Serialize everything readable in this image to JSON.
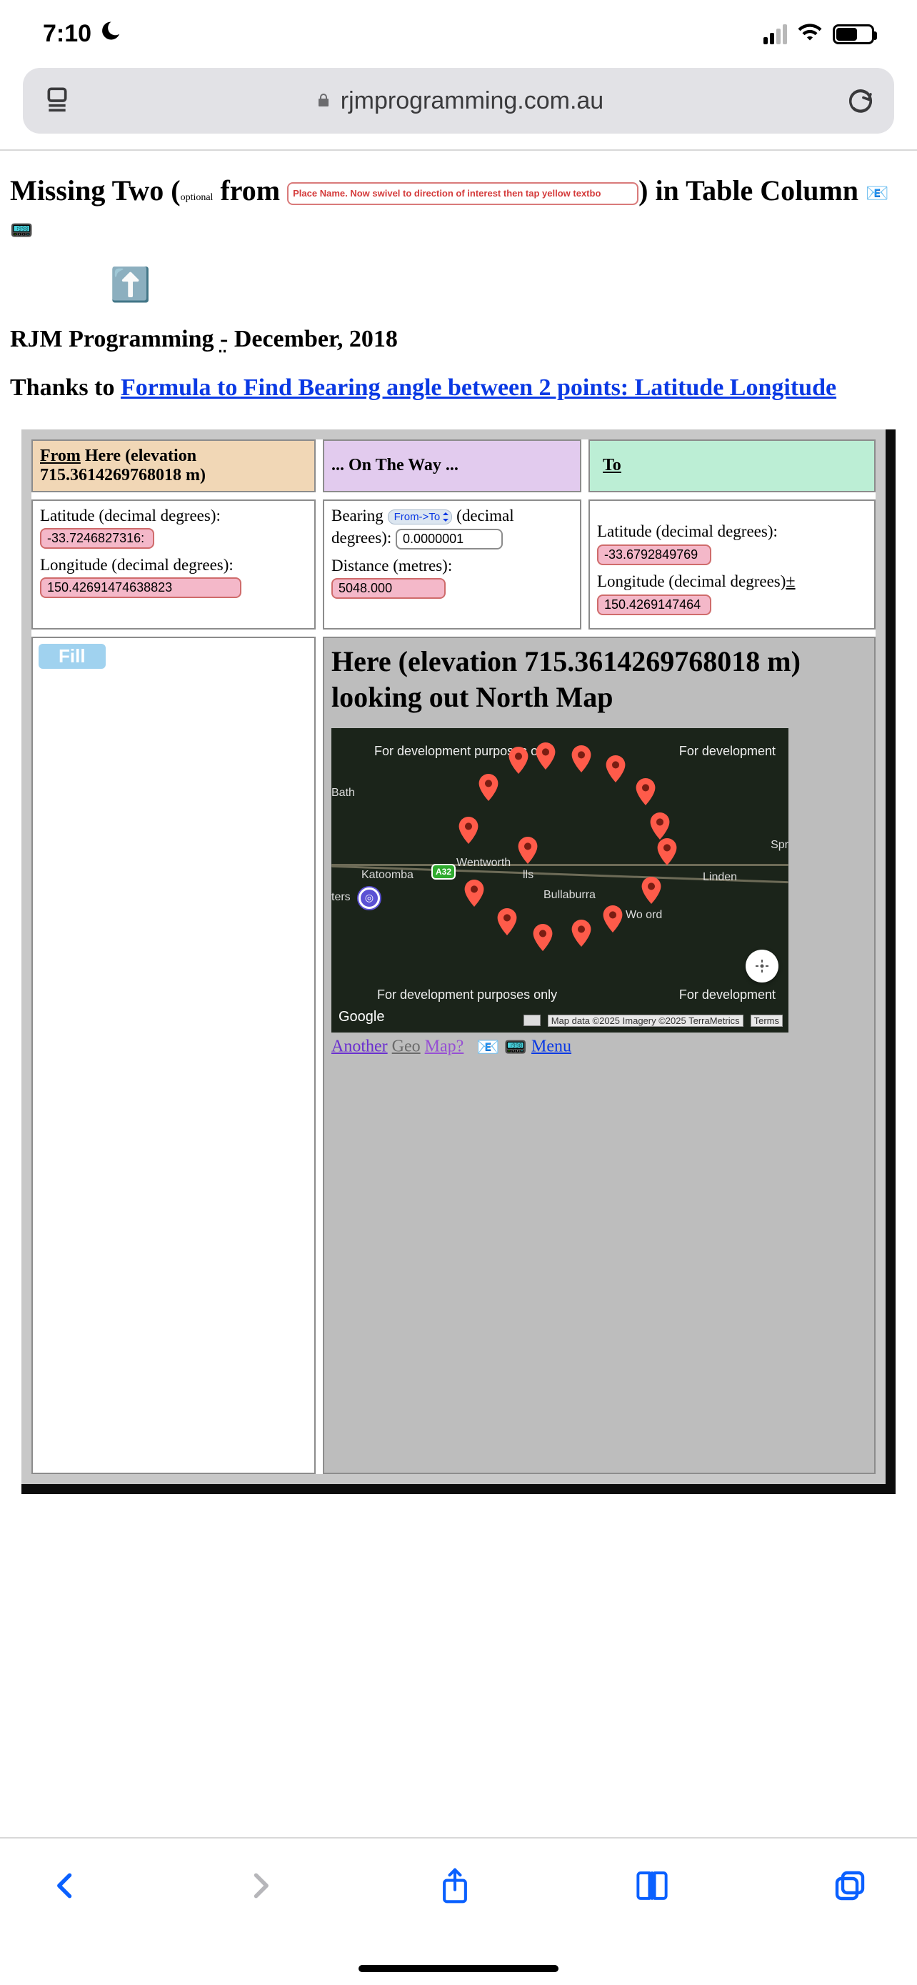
{
  "status": {
    "time": "7:10",
    "focus_mode": "moon"
  },
  "address_bar": {
    "domain": "rjmprogramming.com.au"
  },
  "heading": {
    "pre": "Missing Two (",
    "optional": "optional",
    "from_word": " from ",
    "place_placeholder": "Place Name. Now swivel to direction of interest then tap yellow textbo",
    "post": ") in Table Column "
  },
  "subheading": {
    "org": "RJM Programming ",
    "dash": "-",
    "rest": " December, 2018"
  },
  "thanks": {
    "pre": "Thanks to ",
    "link": "Formula to Find Bearing angle between 2 points: Latitude Longitude"
  },
  "table": {
    "from_header_pre": "From",
    "from_header_post": "  Here (elevation 715.3614269768018 m)",
    "way_header": "... On The Way ...",
    "to_header": "To",
    "from": {
      "lat_label": "Latitude (decimal degrees):",
      "lat_value": "-33.7246827316:",
      "lon_label": "Longitude (decimal degrees):",
      "lon_value": "150.42691474638823"
    },
    "way": {
      "bearing_label_pre": "Bearing ",
      "bearing_select": "From->To",
      "bearing_label_post": " (decimal degrees): ",
      "bearing_value": "0.0000001",
      "dist_label": "Distance (metres):",
      "dist_value": "5048.000"
    },
    "to": {
      "lat_label": "Latitude (decimal degrees): ",
      "lat_value": "-33.6792849769",
      "lon_label": "Longitude (decimal degrees)",
      "pm": "±",
      "lon_value": "150.4269147464"
    }
  },
  "fill_label": "Fill",
  "map_panel": {
    "title": "Here (elevation 715.3614269768018 m) looking out North Map",
    "dev_watermark": "For development purposes only",
    "dev_watermark_short": "For development",
    "places": {
      "katoomba": "Katoomba",
      "wentworth": "Wentworth",
      "lls": "lls",
      "bullaburra": "Bullaburra",
      "woodford": "Wo    ord",
      "linden": "Linden",
      "bath": "Bath",
      "ters": "ters",
      "spr": "Spr"
    },
    "shield": "A32",
    "google": "Google",
    "credit": "Map data ©2025 Imagery ©2025 TerraMetrics",
    "terms": "Terms"
  },
  "below_map": {
    "another": "Another",
    "geo": "Geo",
    "map": "Map?",
    "menu": "Menu"
  }
}
